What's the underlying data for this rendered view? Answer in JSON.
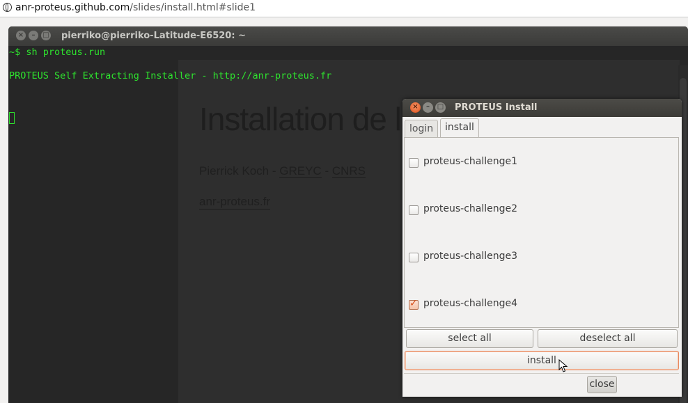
{
  "browser": {
    "url_host": "anr-proteus.github.com",
    "url_path": "/slides/install.html#slide1"
  },
  "terminal": {
    "title": "pierriko@pierriko-Latitude-E6520: ~",
    "lines": [
      "~$ sh proteus.run",
      "PROTEUS Self Extracting Installer - http://anr-proteus.fr"
    ]
  },
  "slide": {
    "title": "Installation de la distribution PROTEUS",
    "author": "Pierrick Koch - ",
    "link1": "GREYC",
    "sep": " - ",
    "link2": "CNRS",
    "site": "anr-proteus.fr"
  },
  "dialog": {
    "title": "PROTEUS Install",
    "tabs": [
      {
        "label": "login",
        "active": false
      },
      {
        "label": "install",
        "active": true
      }
    ],
    "items": [
      {
        "label": "proteus-challenge1",
        "checked": false
      },
      {
        "label": "proteus-challenge2",
        "checked": false
      },
      {
        "label": "proteus-challenge3",
        "checked": false
      },
      {
        "label": "proteus-challenge4",
        "checked": true
      }
    ],
    "select_all_label": "select all",
    "deselect_all_label": "deselect all",
    "install_label": "install",
    "close_label": "close"
  },
  "window_buttons": {
    "close": "×",
    "minimize": "–",
    "maximize": "□"
  },
  "colors": {
    "terminal_text": "#2ee22e",
    "accent": "#df4b16"
  }
}
